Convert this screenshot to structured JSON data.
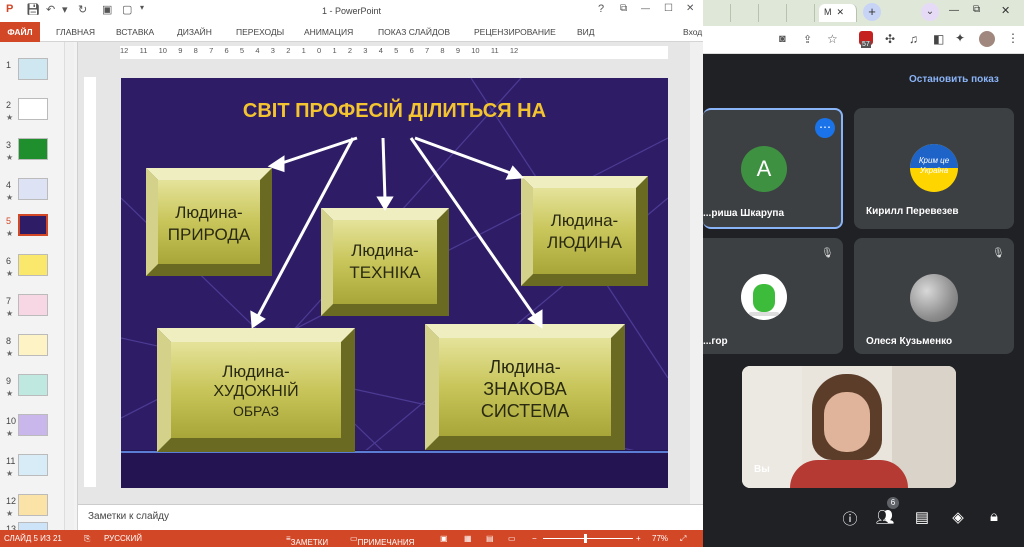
{
  "powerpoint": {
    "window_title": "1 - PowerPoint",
    "window_buttons": {
      "help": "?",
      "restore": "⧉",
      "minimize": "—",
      "maximize": "☐",
      "close": "✕"
    },
    "ribbon_tabs": [
      "ФАЙЛ",
      "ГЛАВНАЯ",
      "ВСТАВКА",
      "ДИЗАЙН",
      "ПЕРЕХОДЫ",
      "АНИМАЦИЯ",
      "ПОКАЗ СЛАЙДОВ",
      "РЕЦЕНЗИРОВАНИЕ",
      "ВИД",
      "Вход"
    ],
    "ruler_labels": [
      "12",
      "11",
      "10",
      "9",
      "8",
      "7",
      "6",
      "5",
      "4",
      "3",
      "2",
      "1",
      "0",
      "1",
      "2",
      "3",
      "4",
      "5",
      "6",
      "7",
      "8",
      "9",
      "10",
      "11",
      "12"
    ],
    "slides": [
      {
        "num": "1",
        "star": ""
      },
      {
        "num": "2",
        "star": "★"
      },
      {
        "num": "3",
        "star": "★"
      },
      {
        "num": "4",
        "star": "★"
      },
      {
        "num": "5",
        "star": "★"
      },
      {
        "num": "6",
        "star": "★"
      },
      {
        "num": "7",
        "star": "★"
      },
      {
        "num": "8",
        "star": "★"
      },
      {
        "num": "9",
        "star": "★"
      },
      {
        "num": "10",
        "star": "★"
      },
      {
        "num": "11",
        "star": "★"
      },
      {
        "num": "12",
        "star": "★"
      },
      {
        "num": "13",
        "star": ""
      }
    ],
    "selected_slide": "5",
    "slide": {
      "title": "СВІТ ПРОФЕСІЙ ДІЛИТЬСЯ НА",
      "boxes": {
        "pryroda": [
          "Людина-",
          "ПРИРОДА"
        ],
        "tekhnika": [
          "Людина-",
          "ТЕХНІКА"
        ],
        "lyudyna": [
          "Людина-",
          "ЛЮДИНА"
        ],
        "obraz": [
          "Людина-",
          "ХУДОЖНІЙ",
          "ОБРАЗ"
        ],
        "systema": [
          "Людина-",
          "ЗНАКОВА",
          "СИСТЕМА"
        ]
      }
    },
    "notes_placeholder": "Заметки к слайду",
    "status": {
      "slide": "СЛАЙД 5 ИЗ 21",
      "language": "РУССКИЙ",
      "notes": "ЗАМЕТКИ",
      "comments": "ПРИМЕЧАНИЯ",
      "zoom": "77%"
    }
  },
  "meet": {
    "tab_labels": [
      "М",
      "✕"
    ],
    "stop_presenting": "Остановить показ",
    "participants": [
      {
        "name": "...риша Шкарупа",
        "avatar_letter": "A",
        "avatar_color": "#3f9142"
      },
      {
        "name": "Кирилл Перевезев",
        "badge_text": [
          "Крим це",
          "Україна"
        ]
      },
      {
        "name": "...гор",
        "muted": true
      },
      {
        "name": "Олеся Кузьменко",
        "muted": true
      },
      {
        "name": "Вы"
      }
    ],
    "people_count": "6",
    "profile_badge": "57",
    "colors": {
      "accent": "#8ab4f8",
      "tile_border": "#8ab4f8",
      "ppt_orange": "#d24726",
      "slide_bg": "#2e1d66",
      "title_gold": "#f4c430"
    }
  }
}
